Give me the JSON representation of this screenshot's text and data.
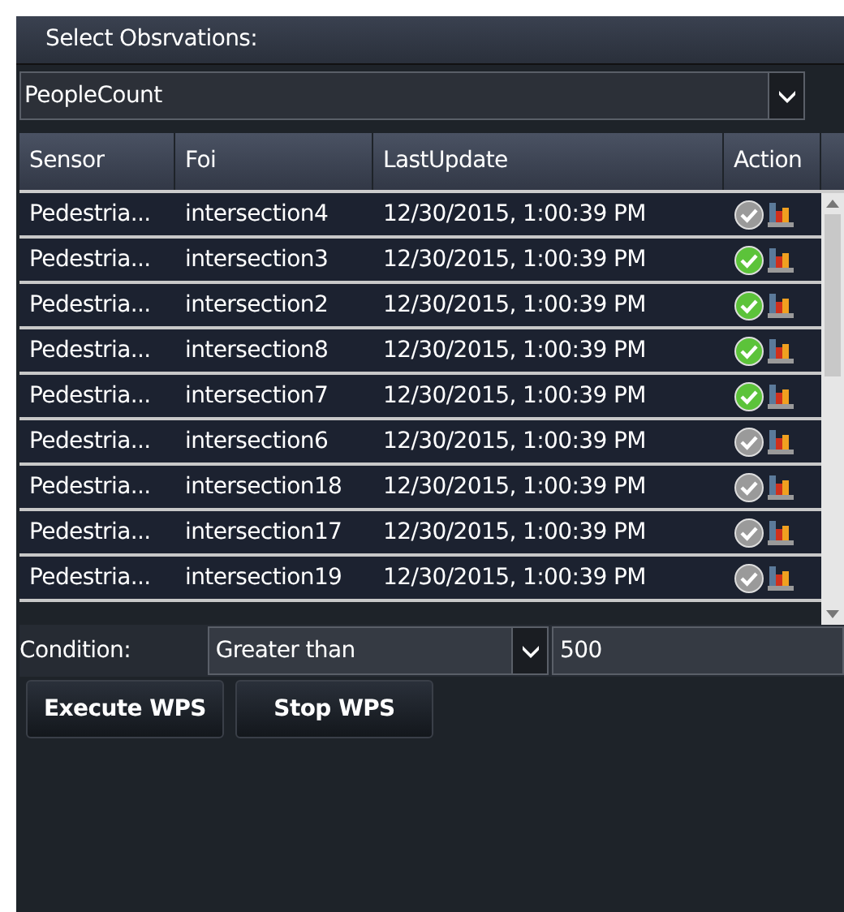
{
  "panel": {
    "title": "Select Obsrvations:"
  },
  "observation_select": {
    "value": "PeopleCount"
  },
  "table": {
    "columns": [
      "Sensor",
      "Foi",
      "LastUpdate",
      "Action"
    ],
    "rows": [
      {
        "sensor": "Pedestria...",
        "foi": "intersection4",
        "last_update": "12/30/2015, 1:00:39 PM",
        "active": false
      },
      {
        "sensor": "Pedestria...",
        "foi": "intersection3",
        "last_update": "12/30/2015, 1:00:39 PM",
        "active": true
      },
      {
        "sensor": "Pedestria...",
        "foi": "intersection2",
        "last_update": "12/30/2015, 1:00:39 PM",
        "active": true
      },
      {
        "sensor": "Pedestria...",
        "foi": "intersection8",
        "last_update": "12/30/2015, 1:00:39 PM",
        "active": true
      },
      {
        "sensor": "Pedestria...",
        "foi": "intersection7",
        "last_update": "12/30/2015, 1:00:39 PM",
        "active": true
      },
      {
        "sensor": "Pedestria...",
        "foi": "intersection6",
        "last_update": "12/30/2015, 1:00:39 PM",
        "active": false
      },
      {
        "sensor": "Pedestria...",
        "foi": "intersection18",
        "last_update": "12/30/2015, 1:00:39 PM",
        "active": false
      },
      {
        "sensor": "Pedestria...",
        "foi": "intersection17",
        "last_update": "12/30/2015, 1:00:39 PM",
        "active": false
      },
      {
        "sensor": "Pedestria...",
        "foi": "intersection19",
        "last_update": "12/30/2015, 1:00:39 PM",
        "active": false
      }
    ]
  },
  "condition": {
    "label": "Condition:",
    "operator": "Greater than",
    "value": "500"
  },
  "buttons": [
    "Execute WPS",
    "Stop WPS"
  ]
}
